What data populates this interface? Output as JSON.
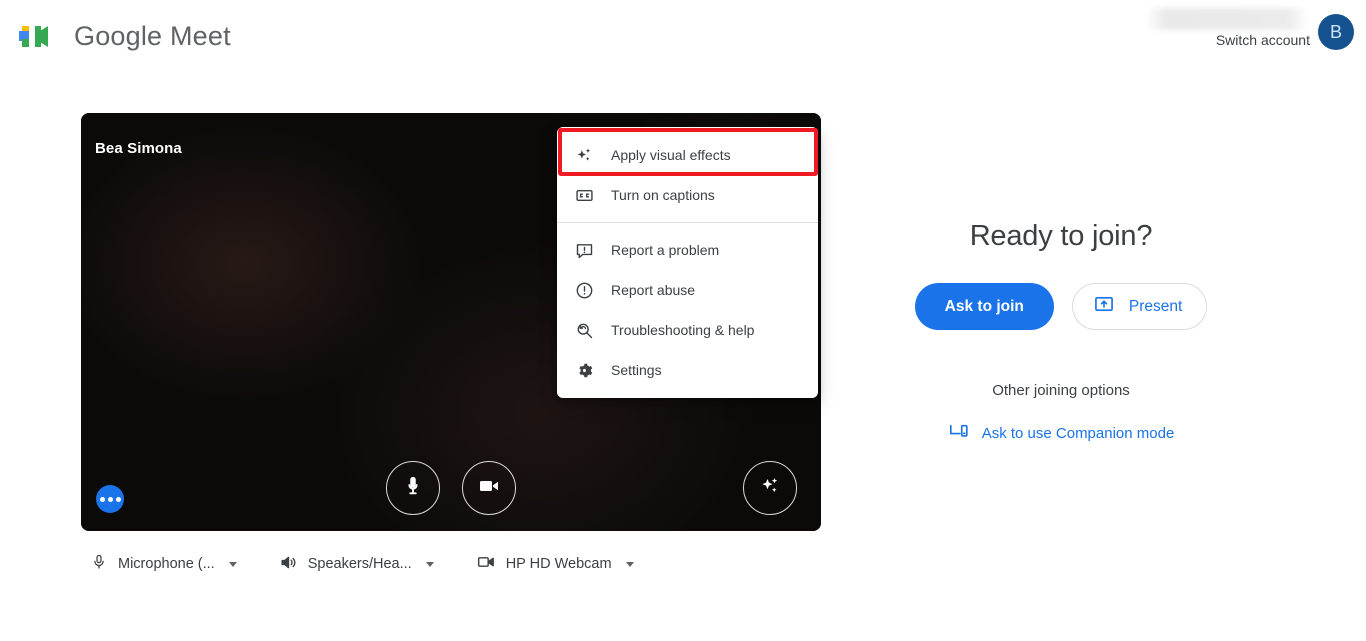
{
  "header": {
    "brand_name": "Google Meet",
    "logo_icon": "google-meet-logo",
    "account": {
      "redacted_email": "",
      "switch_account_label": "Switch account",
      "avatar_initial": "B",
      "avatar_color": "#14528f"
    }
  },
  "video_preview": {
    "self_name": "Bea Simona",
    "more_options_icon": "more-horizontal-icon",
    "controls": [
      {
        "name": "microphone-toggle",
        "icon": "microphone-icon"
      },
      {
        "name": "camera-toggle",
        "icon": "video-camera-icon"
      }
    ],
    "effects_button": {
      "name": "visual-effects-button",
      "icon": "sparkles-icon"
    }
  },
  "context_menu": {
    "groups": [
      {
        "items": [
          {
            "label": "Apply visual effects",
            "icon": "sparkles-icon",
            "highlighted": true
          },
          {
            "label": "Turn on captions",
            "icon": "closed-captions-icon",
            "highlighted": false
          }
        ]
      },
      {
        "items": [
          {
            "label": "Report a problem",
            "icon": "feedback-icon",
            "highlighted": false
          },
          {
            "label": "Report abuse",
            "icon": "error-circle-icon",
            "highlighted": false
          },
          {
            "label": "Troubleshooting & help",
            "icon": "troubleshoot-icon",
            "highlighted": false
          },
          {
            "label": "Settings",
            "icon": "gear-icon",
            "highlighted": false
          }
        ]
      }
    ],
    "highlight_color": "#ee1b23"
  },
  "device_bar": [
    {
      "label": "Microphone (...",
      "icon": "microphone-icon"
    },
    {
      "label": "Speakers/Hea...",
      "icon": "speaker-icon"
    },
    {
      "label": "HP HD Webcam",
      "icon": "video-camera-icon"
    }
  ],
  "join_panel": {
    "title": "Ready to join?",
    "ask_to_join_label": "Ask to join",
    "present_label": "Present",
    "present_icon": "present-screen-icon",
    "other_options_label": "Other joining options",
    "companion_label": "Ask to use Companion mode",
    "companion_icon": "companion-device-icon",
    "accent_color": "#1a73e8"
  }
}
